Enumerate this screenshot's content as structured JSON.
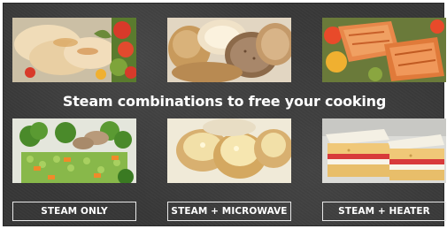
{
  "headline": "Steam combinations to free your cooking",
  "photos": [
    {
      "icon": "chicken-vegetables-photo"
    },
    {
      "icon": "bread-loaves-photo"
    },
    {
      "icon": "salmon-fillet-photo"
    },
    {
      "icon": "steamed-vegetables-photo"
    },
    {
      "icon": "baked-potatoes-photo"
    },
    {
      "icon": "sponge-cake-photo"
    }
  ],
  "modes": [
    {
      "label": "STEAM ONLY"
    },
    {
      "label": "STEAM + MICROWAVE"
    },
    {
      "label": "STEAM + HEATER"
    }
  ],
  "colors": {
    "background": "#373737",
    "text": "#ffffff",
    "border": "#e8e8e8"
  }
}
